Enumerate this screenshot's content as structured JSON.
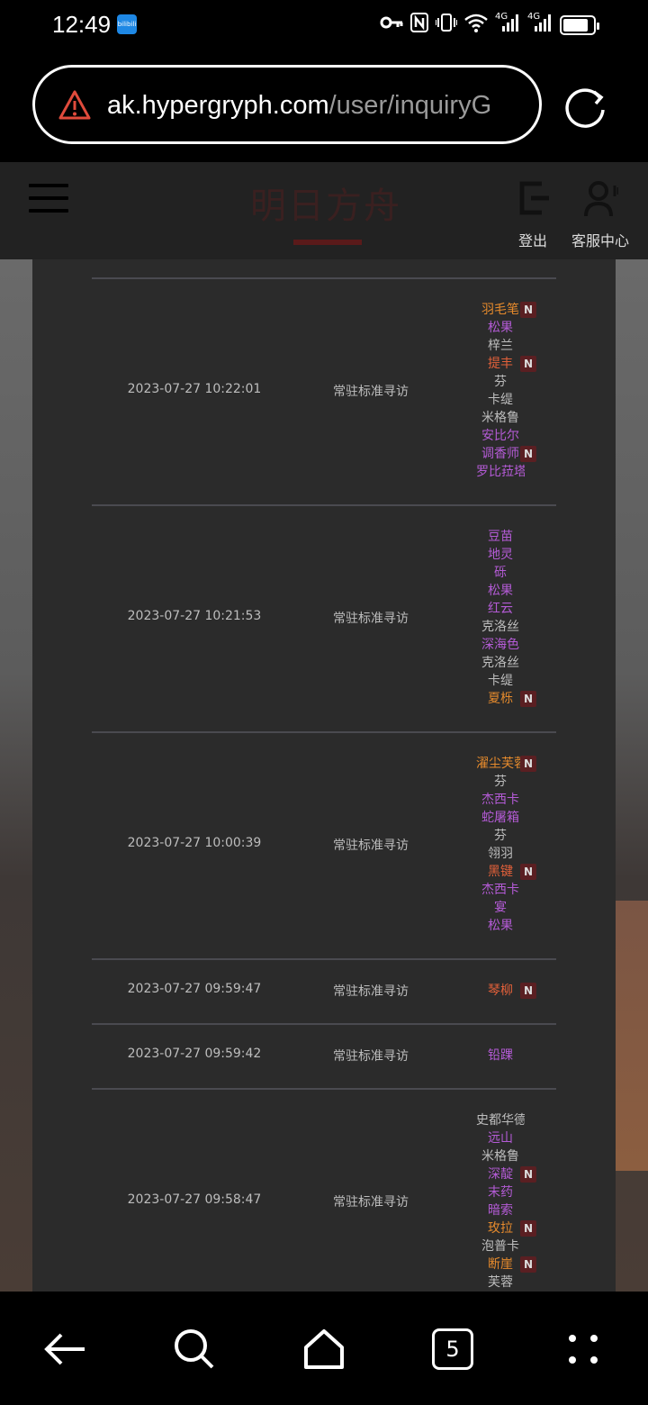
{
  "status": {
    "time": "12:49",
    "app_badge": "bilibili",
    "signal_label_1": "4G",
    "signal_label_2": "4G",
    "battery_level": 0.85
  },
  "urlbar": {
    "host": "ak.hypergryph.com",
    "path": "/user/inquiryG"
  },
  "header": {
    "logo_text": "明日方舟",
    "logout_label": "登出",
    "service_label": "客服中心"
  },
  "records": [
    {
      "time": "2023-07-27 10:22:01",
      "type": "常驻标准寻访",
      "operators": [
        {
          "name": "羽毛笔",
          "rarity": "r6",
          "new": true
        },
        {
          "name": "松果",
          "rarity": "r5",
          "new": false
        },
        {
          "name": "梓兰",
          "rarity": "r3",
          "new": false
        },
        {
          "name": "提丰",
          "rarity": "r6b",
          "new": true
        },
        {
          "name": "芬",
          "rarity": "r3",
          "new": false
        },
        {
          "name": "卡缇",
          "rarity": "r3",
          "new": false
        },
        {
          "name": "米格鲁",
          "rarity": "r3",
          "new": false
        },
        {
          "name": "安比尔",
          "rarity": "r5",
          "new": false
        },
        {
          "name": "调香师",
          "rarity": "r5",
          "new": true
        },
        {
          "name": "罗比菈塔",
          "rarity": "r5",
          "new": false
        }
      ]
    },
    {
      "time": "2023-07-27 10:21:53",
      "type": "常驻标准寻访",
      "operators": [
        {
          "name": "豆苗",
          "rarity": "r5",
          "new": false
        },
        {
          "name": "地灵",
          "rarity": "r5",
          "new": false
        },
        {
          "name": "砾",
          "rarity": "r5",
          "new": false
        },
        {
          "name": "松果",
          "rarity": "r5",
          "new": false
        },
        {
          "name": "红云",
          "rarity": "r5",
          "new": false
        },
        {
          "name": "克洛丝",
          "rarity": "r3",
          "new": false
        },
        {
          "name": "深海色",
          "rarity": "r5",
          "new": false
        },
        {
          "name": "克洛丝",
          "rarity": "r3",
          "new": false
        },
        {
          "name": "卡缇",
          "rarity": "r3",
          "new": false
        },
        {
          "name": "夏栎",
          "rarity": "r6",
          "new": true
        }
      ]
    },
    {
      "time": "2023-07-27 10:00:39",
      "type": "常驻标准寻访",
      "operators": [
        {
          "name": "濯尘芙蓉",
          "rarity": "r6",
          "new": true
        },
        {
          "name": "芬",
          "rarity": "r3",
          "new": false
        },
        {
          "name": "杰西卡",
          "rarity": "r5",
          "new": false
        },
        {
          "name": "蛇屠箱",
          "rarity": "r5",
          "new": false
        },
        {
          "name": "芬",
          "rarity": "r3",
          "new": false
        },
        {
          "name": "翎羽",
          "rarity": "r3",
          "new": false
        },
        {
          "name": "黑键",
          "rarity": "r6b",
          "new": true
        },
        {
          "name": "杰西卡",
          "rarity": "r5",
          "new": false
        },
        {
          "name": "宴",
          "rarity": "r5",
          "new": false
        },
        {
          "name": "松果",
          "rarity": "r5",
          "new": false
        }
      ]
    },
    {
      "time": "2023-07-27 09:59:47",
      "type": "常驻标准寻访",
      "operators": [
        {
          "name": "琴柳",
          "rarity": "r6b",
          "new": true
        }
      ]
    },
    {
      "time": "2023-07-27 09:59:42",
      "type": "常驻标准寻访",
      "operators": [
        {
          "name": "铅踝",
          "rarity": "r5",
          "new": false
        }
      ]
    },
    {
      "time": "2023-07-27 09:58:47",
      "type": "常驻标准寻访",
      "operators": [
        {
          "name": "史都华德",
          "rarity": "r3",
          "new": false
        },
        {
          "name": "远山",
          "rarity": "r5",
          "new": false
        },
        {
          "name": "米格鲁",
          "rarity": "r3",
          "new": false
        },
        {
          "name": "深靛",
          "rarity": "r5",
          "new": true
        },
        {
          "name": "末药",
          "rarity": "r5",
          "new": false
        },
        {
          "name": "暗索",
          "rarity": "r5",
          "new": false
        },
        {
          "name": "玫拉",
          "rarity": "r6",
          "new": true
        },
        {
          "name": "泡普卡",
          "rarity": "r3",
          "new": false
        },
        {
          "name": "断崖",
          "rarity": "r6",
          "new": true
        },
        {
          "name": "芙蓉",
          "rarity": "r3",
          "new": false
        }
      ]
    }
  ],
  "new_badge": "N",
  "nav": {
    "tabs_count": "5"
  },
  "colors": {
    "six_star": "#e58a2c",
    "five_star": "#b45bd6",
    "three_star": "#bdbdbd",
    "panel_bg": "#2b2b2b"
  }
}
